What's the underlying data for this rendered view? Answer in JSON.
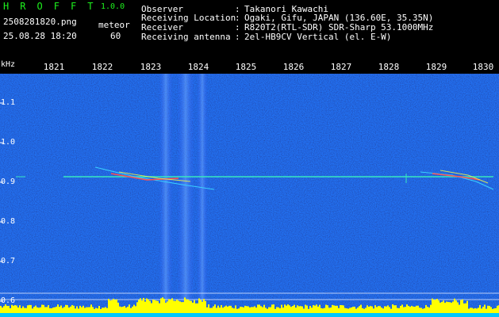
{
  "app": {
    "title": "H R O F F T",
    "version": "1.0.0",
    "filename": "2508281820.png",
    "timestamp": "25.08.28 18:20",
    "detector_label": "meteor",
    "detector_value": "60"
  },
  "info": [
    {
      "label": "Observer",
      "value": "Takanori Kawachi"
    },
    {
      "label": "Receiving Location",
      "value": "Ogaki, Gifu, JAPAN (136.60E, 35.35N)"
    },
    {
      "label": "Receiver",
      "value": "R820T2(RTL-SDR) SDR-Sharp 53.1000MHz"
    },
    {
      "label": "Receiving antenna",
      "value": "2el-HB9CV Vertical (el. E-W)"
    }
  ],
  "xaxis": {
    "ticks": [
      "1821",
      "1822",
      "1823",
      "1824",
      "1825",
      "1826",
      "1827",
      "1828",
      "1829",
      "1830"
    ]
  },
  "yaxis": {
    "unit": "kHz",
    "ticks": [
      "1.1",
      "1.0",
      "0.9",
      "0.8",
      "0.7",
      "0.6"
    ]
  },
  "colors": {
    "background": "#000000",
    "noise": "#0a1a9c",
    "text": "#ffffff",
    "title": "#1ef21e",
    "signal": "#38e8c0",
    "bars": "#ffff00",
    "baseline": "#00c8ff"
  }
}
